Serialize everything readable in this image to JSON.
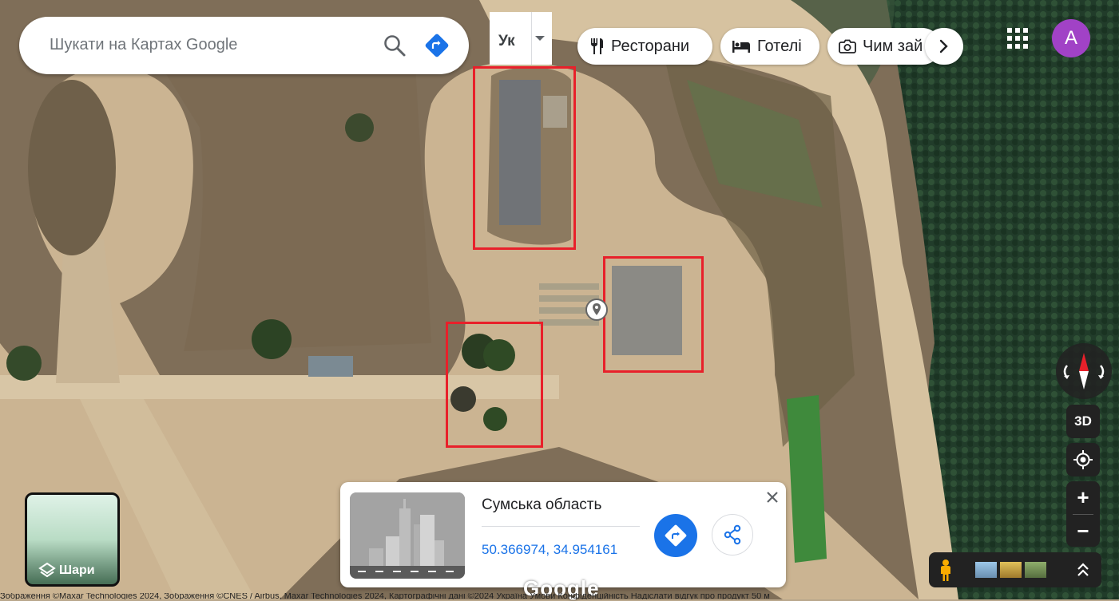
{
  "search": {
    "placeholder": "Шукати на Картах Google"
  },
  "language": {
    "label": "Ук"
  },
  "chips": [
    {
      "label": "Ресторани",
      "icon": "restaurant-icon"
    },
    {
      "label": "Готелі",
      "icon": "hotel-icon"
    },
    {
      "label": "Чим зай",
      "icon": "camera-icon"
    }
  ],
  "account": {
    "initial": "A",
    "color": "#a142c6"
  },
  "layers": {
    "label": "Шари"
  },
  "place_card": {
    "title": "Сумська область",
    "coordinates": "50.366974, 34.954161"
  },
  "controls": {
    "three_d": "3D",
    "zoom_in": "+",
    "zoom_out": "−"
  },
  "logo": "Google",
  "footer_text": "Зображення ©Maxar Technologies 2024, Зображення ©CNES / Airbus, Maxar Technologies 2024, Картографічні дані ©2024  Україна  Умови  Конфіденційність  Надіслати відгук про продукт  50 м",
  "colors": {
    "accent": "#1a73e8",
    "marker": "#e8202a"
  }
}
